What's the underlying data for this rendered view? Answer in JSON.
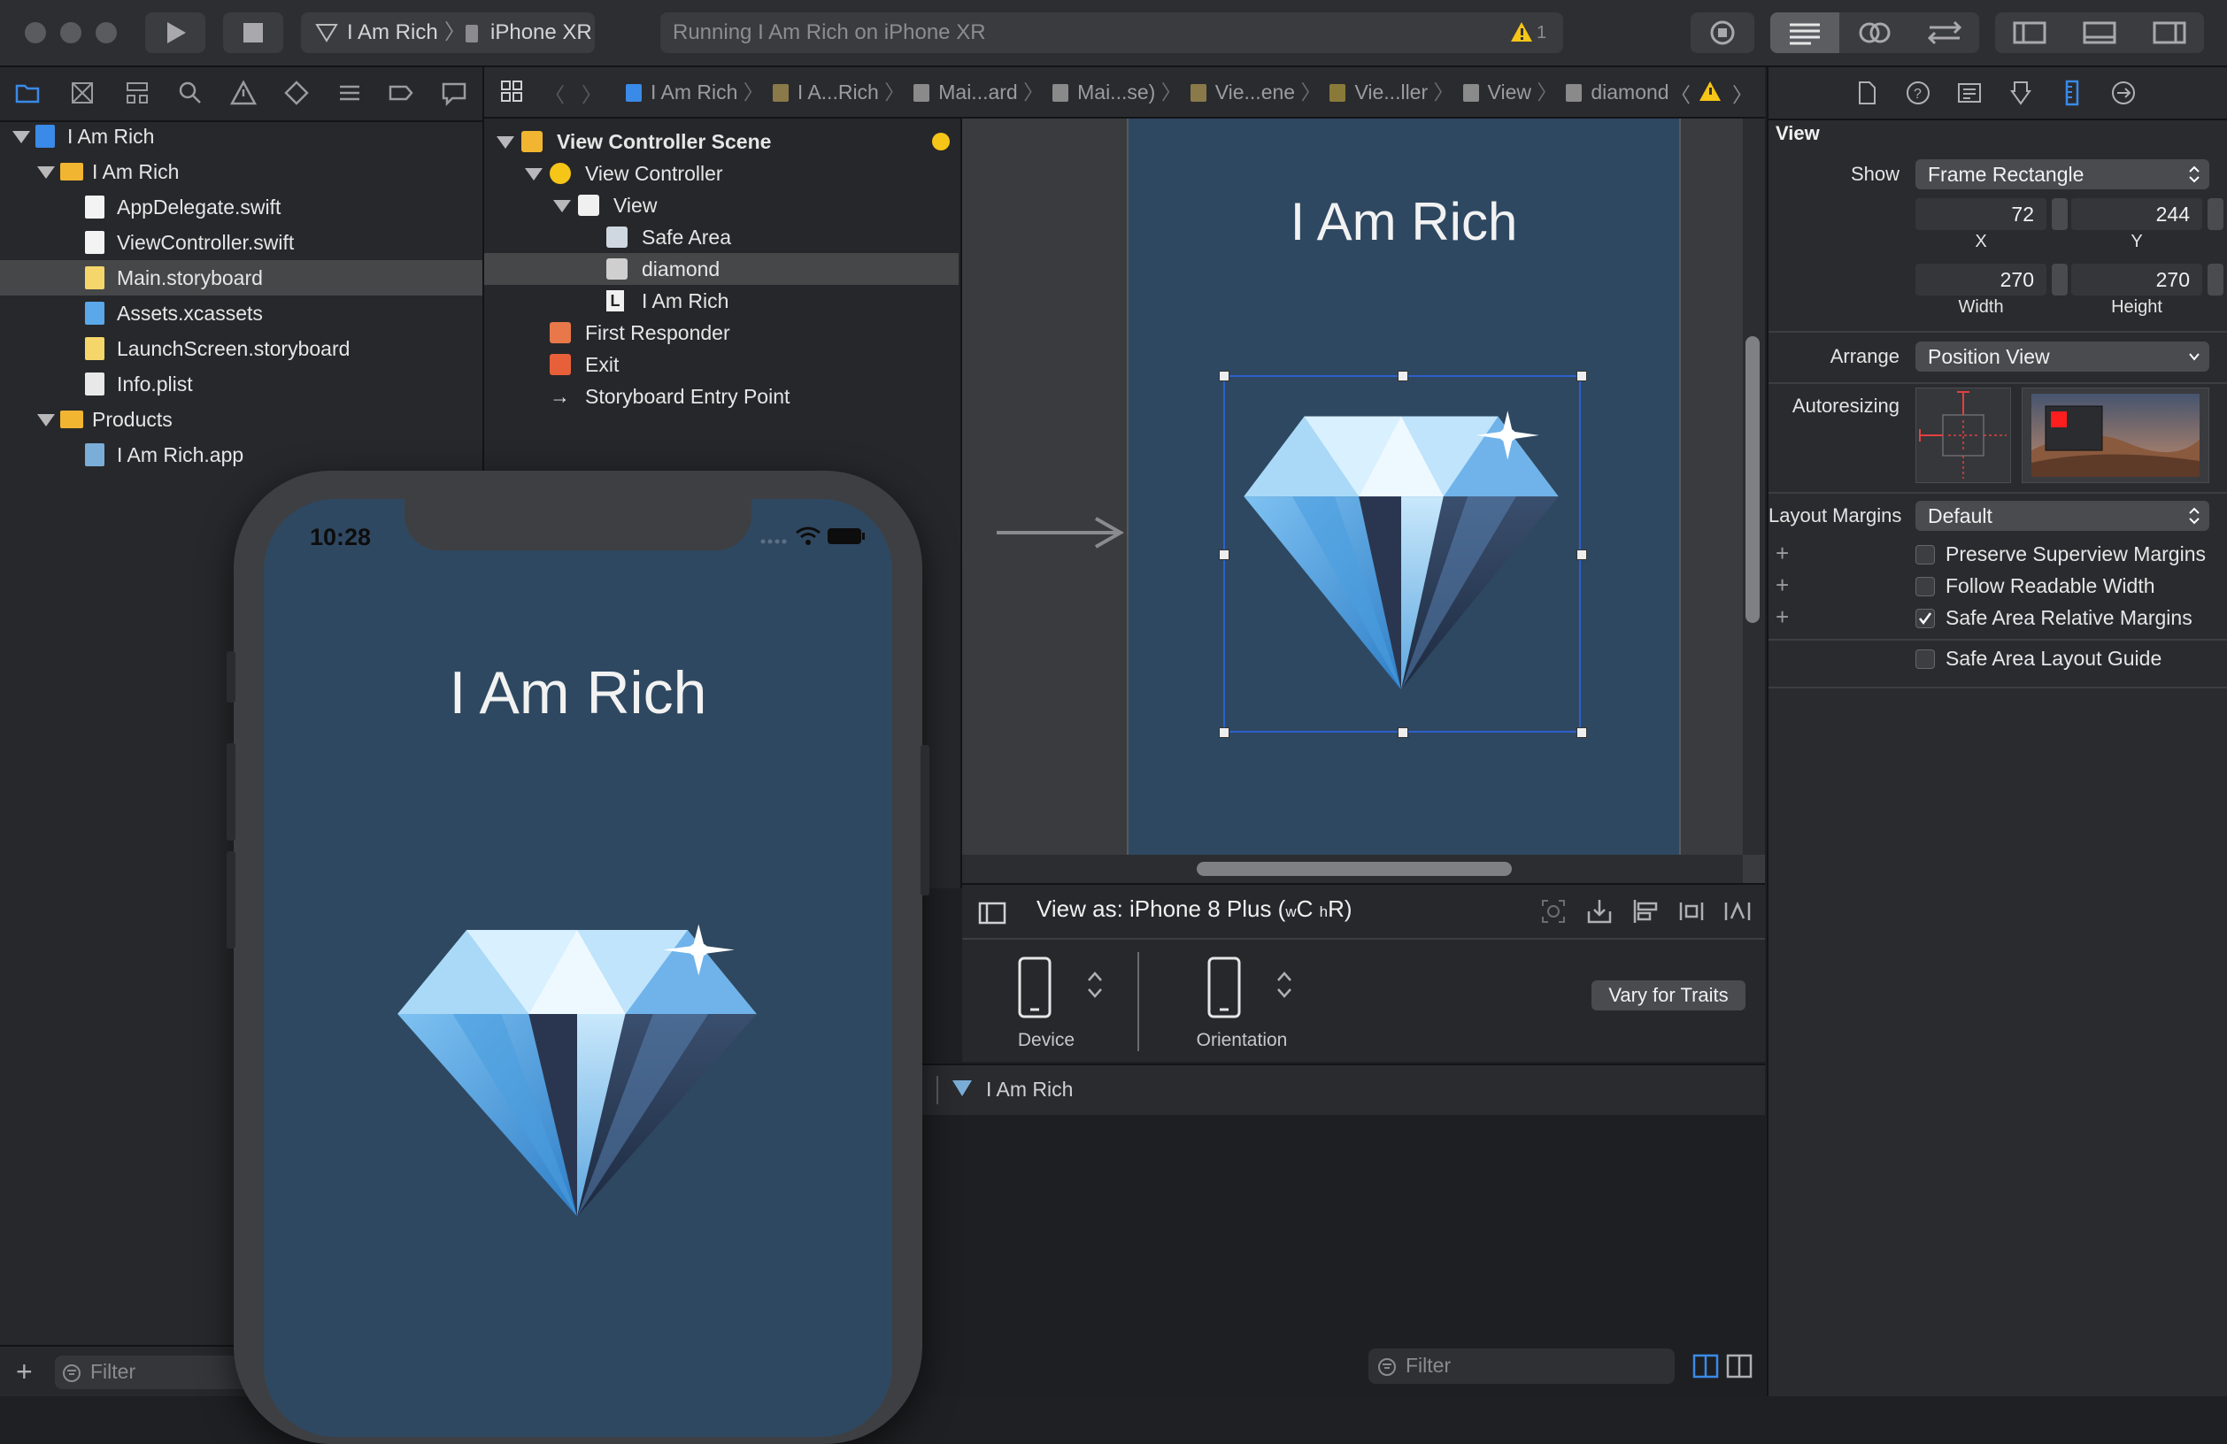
{
  "toolbar": {
    "scheme_target": "I Am Rich",
    "scheme_device": "iPhone XR",
    "status_text": "Running I Am Rich on iPhone XR",
    "warning_count": "1"
  },
  "navigator": {
    "items": [
      {
        "label": "I Am Rich",
        "kind": "project"
      },
      {
        "label": "I Am Rich",
        "kind": "folder"
      },
      {
        "label": "AppDelegate.swift",
        "kind": "swift"
      },
      {
        "label": "ViewController.swift",
        "kind": "swift"
      },
      {
        "label": "Main.storyboard",
        "kind": "storyboard",
        "selected": true
      },
      {
        "label": "Assets.xcassets",
        "kind": "assets"
      },
      {
        "label": "LaunchScreen.storyboard",
        "kind": "storyboard"
      },
      {
        "label": "Info.plist",
        "kind": "plist"
      },
      {
        "label": "Products",
        "kind": "folder"
      },
      {
        "label": "I Am Rich.app",
        "kind": "app"
      }
    ],
    "filter_placeholder": "Filter"
  },
  "jumpbar": {
    "crumbs": [
      "I Am Rich",
      "I A...Rich",
      "Mai...ard",
      "Mai...se)",
      "Vie...ene",
      "Vie...ller",
      "View",
      "diamond"
    ]
  },
  "outline": {
    "items": [
      {
        "label": "View Controller Scene",
        "bold": true
      },
      {
        "label": "View Controller"
      },
      {
        "label": "View"
      },
      {
        "label": "Safe Area"
      },
      {
        "label": "diamond",
        "selected": true
      },
      {
        "label": "I Am Rich"
      },
      {
        "label": "First Responder"
      },
      {
        "label": "Exit"
      },
      {
        "label": "Storyboard Entry Point"
      }
    ]
  },
  "canvas": {
    "scene_title": "I Am Rich"
  },
  "viewas": {
    "title_prefix": "View as: iPhone 8 Plus (",
    "w": "w",
    "c": "C",
    "h": "h",
    "r": "R)",
    "device_label": "Device",
    "orientation_label": "Orientation",
    "vary_button": "Vary for Traits"
  },
  "debug": {
    "target": "I Am Rich",
    "filter_placeholder": "Filter"
  },
  "inspector": {
    "section_title": "View",
    "show_label": "Show",
    "show_value": "Frame Rectangle",
    "x_value": "72",
    "y_value": "244",
    "x_label": "X",
    "y_label": "Y",
    "width_value": "270",
    "height_value": "270",
    "width_label": "Width",
    "height_label": "Height",
    "arrange_label": "Arrange",
    "arrange_value": "Position View",
    "autoresizing_label": "Autoresizing",
    "layout_margins_label": "Layout Margins",
    "layout_margins_value": "Default",
    "checkboxes": [
      {
        "label": "Preserve Superview Margins",
        "checked": false
      },
      {
        "label": "Follow Readable Width",
        "checked": false
      },
      {
        "label": "Safe Area Relative Margins",
        "checked": true
      },
      {
        "label": "Safe Area Layout Guide",
        "checked": false
      }
    ]
  },
  "simulator": {
    "time": "10:28",
    "title": "I Am Rich"
  },
  "colors": {
    "scene_bg": "#2f4861",
    "accent": "#3a8ae8",
    "warning": "#f5c518"
  }
}
